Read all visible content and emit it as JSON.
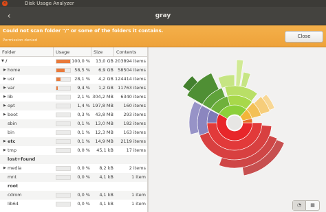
{
  "window": {
    "title": "Disk Usage Analyzer",
    "close_glyph": "×"
  },
  "header": {
    "title": "gray",
    "back_icon": "chevron-left-icon"
  },
  "infobar": {
    "message": "Could not scan folder \"/\" or some of the folders it contains.",
    "detail": "Permission denied",
    "close_label": "Close"
  },
  "columns": {
    "folder": "Folder",
    "usage": "Usage",
    "size": "Size",
    "contents": "Contents"
  },
  "rows": [
    {
      "name": "/",
      "expander": "▼",
      "depth": 0,
      "pct": "100,0 %",
      "size": "13,0 GB",
      "contents": "203894 items",
      "usage": 1.0,
      "bold": true
    },
    {
      "name": "home",
      "expander": "▶",
      "depth": 1,
      "pct": "58,5 %",
      "size": "6,9 GB",
      "contents": "58504 items",
      "usage": 0.585,
      "bold": false
    },
    {
      "name": "usr",
      "expander": "▶",
      "depth": 1,
      "pct": "28,1 %",
      "size": "4,2 GB",
      "contents": "124414 items",
      "usage": 0.281,
      "bold": false
    },
    {
      "name": "var",
      "expander": "▶",
      "depth": 1,
      "pct": "9,4 %",
      "size": "1,2 GB",
      "contents": "11763 items",
      "usage": 0.094,
      "bold": false
    },
    {
      "name": "lib",
      "expander": "▶",
      "depth": 1,
      "pct": "2,1 %",
      "size": "304,2 MB",
      "contents": "6340 items",
      "usage": 0.021,
      "bold": false
    },
    {
      "name": "opt",
      "expander": "▶",
      "depth": 1,
      "pct": "1,4 %",
      "size": "197,8 MB",
      "contents": "160 items",
      "usage": 0.014,
      "bold": false
    },
    {
      "name": "boot",
      "expander": "▶",
      "depth": 1,
      "pct": "0,3 %",
      "size": "43,8 MB",
      "contents": "293 items",
      "usage": 0.003,
      "bold": false
    },
    {
      "name": "sbin",
      "expander": "",
      "depth": 1,
      "pct": "0,1 %",
      "size": "13,0 MB",
      "contents": "182 items",
      "usage": 0.001,
      "bold": false
    },
    {
      "name": "bin",
      "expander": "",
      "depth": 1,
      "pct": "0,1 %",
      "size": "12,3 MB",
      "contents": "163 items",
      "usage": 0.001,
      "bold": false
    },
    {
      "name": "etc",
      "expander": "▶",
      "depth": 1,
      "pct": "0,1 %",
      "size": "14,9 MB",
      "contents": "2119 items",
      "usage": 0.001,
      "bold": true
    },
    {
      "name": "tmp",
      "expander": "▶",
      "depth": 1,
      "pct": "0,0 %",
      "size": "45,1 kB",
      "contents": "17 items",
      "usage": 0.0,
      "bold": false
    },
    {
      "name": "lost+found",
      "expander": "",
      "depth": 1,
      "pct": "",
      "size": "",
      "contents": "",
      "usage": null,
      "bold": true
    },
    {
      "name": "media",
      "expander": "▶",
      "depth": 1,
      "pct": "0,0 %",
      "size": "8,2 kB",
      "contents": "2 items",
      "usage": 0.0,
      "bold": false
    },
    {
      "name": "mnt",
      "expander": "",
      "depth": 1,
      "pct": "0,0 %",
      "size": "4,1 kB",
      "contents": "1 item",
      "usage": 0.0,
      "bold": false
    },
    {
      "name": "root",
      "expander": "",
      "depth": 1,
      "pct": "",
      "size": "",
      "contents": "",
      "usage": null,
      "bold": true
    },
    {
      "name": "cdrom",
      "expander": "",
      "depth": 1,
      "pct": "0,0 %",
      "size": "4,1 kB",
      "contents": "1 item",
      "usage": 0.0,
      "bold": false
    },
    {
      "name": "lib64",
      "expander": "",
      "depth": 1,
      "pct": "0,0 %",
      "size": "4,1 kB",
      "contents": "1 item",
      "usage": 0.0,
      "bold": false
    }
  ],
  "view_switch": {
    "rings_icon": "rings-chart-icon",
    "treemap_icon": "treemap-chart-icon"
  },
  "colors": {
    "accent": "#e95420",
    "infobar": "#f0a940",
    "usage_bar": "#e97a3b"
  }
}
